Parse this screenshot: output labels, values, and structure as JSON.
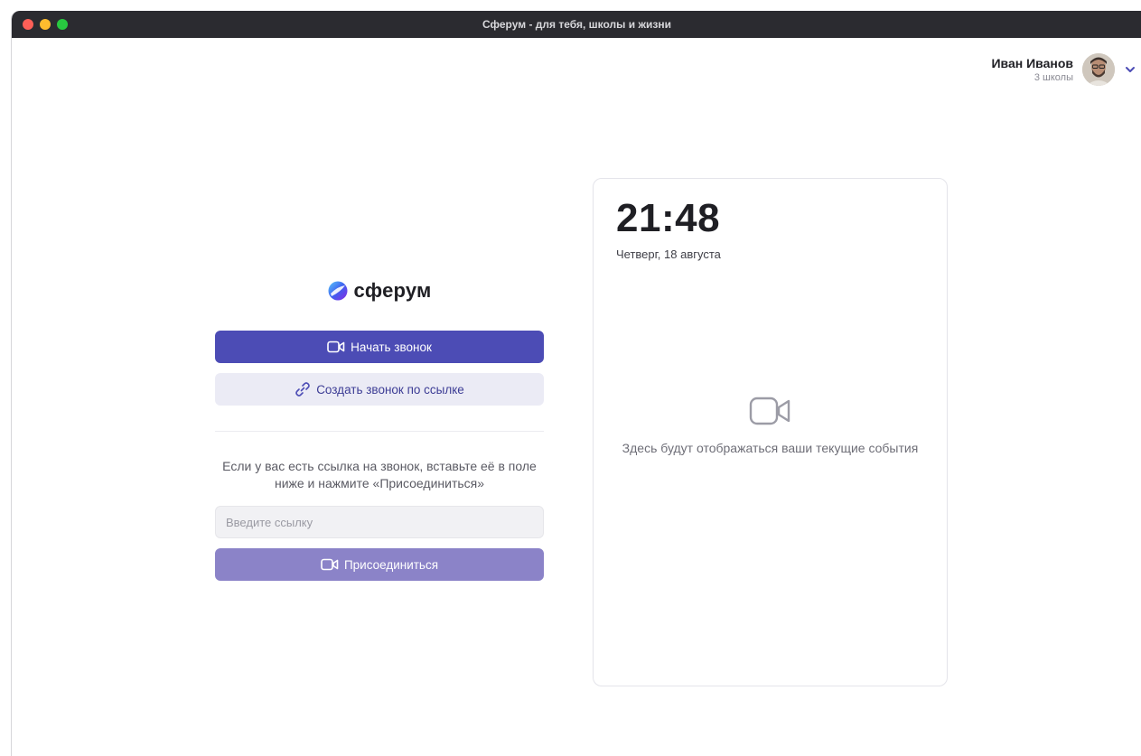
{
  "window": {
    "title": "Сферум - для тебя, школы и жизни"
  },
  "user": {
    "name": "Иван Иванов",
    "subtitle": "3 школы"
  },
  "logo": {
    "text": "сферум"
  },
  "actions": {
    "start_call_label": "Начать звонок",
    "create_link_label": "Создать звонок по ссылке"
  },
  "join": {
    "hint": "Если у вас есть ссылка на звонок, вставьте её в поле ниже и нажмите «Присоединиться»",
    "placeholder": "Введите ссылку",
    "value": "",
    "button_label": "Присоединиться"
  },
  "events": {
    "time": "21:48",
    "date": "Четверг, 18 августа",
    "empty_text": "Здесь будут отображаться ваши текущие события"
  },
  "colors": {
    "primary": "#4c4cb5",
    "secondary_bg": "#ebebf5",
    "join_button": "#8b83c8",
    "titlebar": "#2b2b30"
  },
  "icons": {
    "start_call": "video-camera-icon",
    "create_link": "link-icon",
    "join": "video-camera-icon",
    "empty_state": "video-camera-icon",
    "user_menu": "chevron-down-icon"
  }
}
